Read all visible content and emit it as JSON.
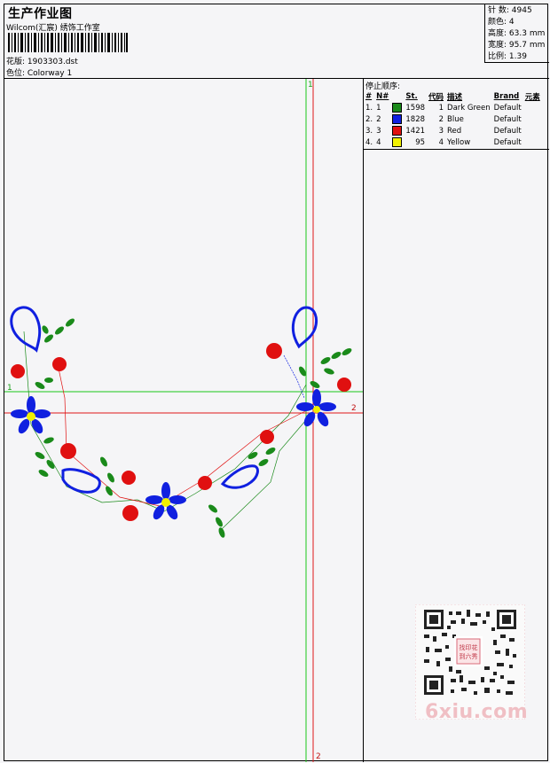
{
  "header": {
    "title": "生产作业图",
    "studio": "Wilcom(汇宸) 绣饰工作室",
    "design": "花版:  1903303.dst",
    "colorway": "色位:  Colorway 1"
  },
  "stats": [
    {
      "label": "针 数:",
      "value": "4945"
    },
    {
      "label": "颜色:",
      "value": "4"
    },
    {
      "label": "高度:",
      "value": "63.3 mm"
    },
    {
      "label": "宽度:",
      "value": "95.7 mm"
    },
    {
      "label": "比例:",
      "value": "1.39"
    }
  ],
  "stop_sequence": {
    "title": "停止顺序:",
    "columns": [
      "#",
      "N#",
      "St.",
      "代码",
      "描述",
      "Brand",
      "元素"
    ],
    "rows": [
      {
        "idx": "1.",
        "n": "1",
        "color": "#1a8a1a",
        "st": "1598",
        "code": "1",
        "desc": "Dark Green",
        "brand": "Default"
      },
      {
        "idx": "2.",
        "n": "2",
        "color": "#1020e0",
        "st": "1828",
        "code": "2",
        "desc": "Blue",
        "brand": "Default"
      },
      {
        "idx": "3.",
        "n": "3",
        "color": "#e01010",
        "st": "1421",
        "code": "3",
        "desc": "Red",
        "brand": "Default"
      },
      {
        "idx": "4.",
        "n": "4",
        "color": "#f0f000",
        "st": "95",
        "code": "4",
        "desc": "Yellow",
        "brand": "Default"
      }
    ]
  },
  "guides": {
    "green_v": "1",
    "green_h": "1",
    "red_h": "2",
    "red_v": "2"
  },
  "watermark": {
    "text": "6xiu.com",
    "stamp": "找印花到六秀"
  }
}
